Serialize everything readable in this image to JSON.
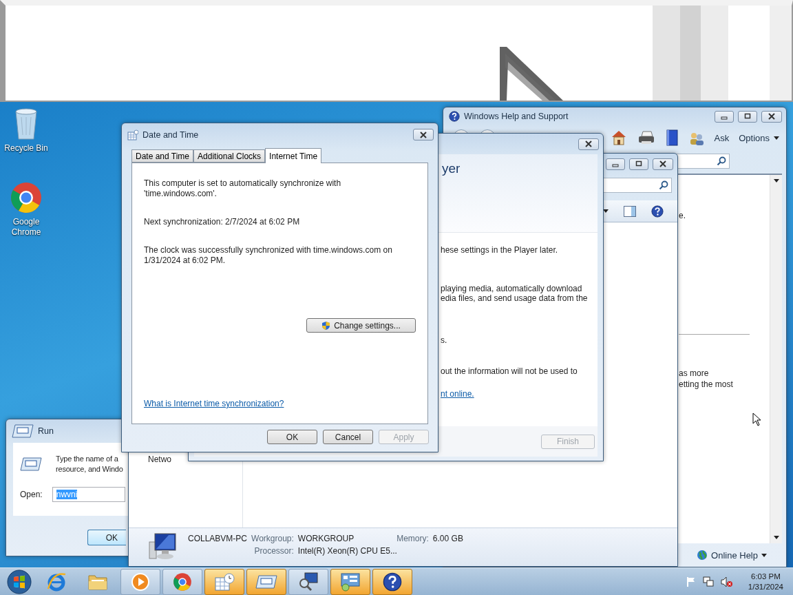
{
  "desktop_icons": [
    {
      "label": "Recycle Bin",
      "kind": "bin"
    },
    {
      "label": "Google Chrome",
      "kind": "chrome"
    }
  ],
  "help_window": {
    "title": "Windows Help and Support",
    "ask": "Ask",
    "options": "Options",
    "fragments": [
      "e.",
      "as more",
      "etting the most"
    ],
    "online_help": "Online Help"
  },
  "explorer_window": {
    "nav_item": "Netwo",
    "computer_name": "COLLABVM-PC",
    "workgroup_label": "Workgroup:",
    "workgroup": "WORKGROUP",
    "memory_label": "Memory:",
    "memory": "6.00 GB",
    "processor_label": "Processor:",
    "processor": "Intel(R) Xeon(R) CPU E5..."
  },
  "media_dialog": {
    "heading": "yer",
    "paragraphs": [
      [
        "hese settings in the Player later."
      ],
      [
        "playing media, automatically download",
        "edia files, and send usage data from the"
      ],
      [
        "s."
      ],
      [
        "out the information will not be used to"
      ]
    ],
    "link": "nt online.",
    "finish": {
      "label": "Finish",
      "disabled": true
    }
  },
  "run_dialog": {
    "title": "Run",
    "prompt": [
      "Type the name of a",
      "resource, and Windo"
    ],
    "open_label": "Open:",
    "value": "nwvni",
    "ok": "OK"
  },
  "date_time": {
    "title": "Date and Time",
    "tabs": [
      {
        "label": "Date and Time",
        "selected": false
      },
      {
        "label": "Additional Clocks",
        "selected": false
      },
      {
        "label": "Internet Time",
        "selected": true
      }
    ],
    "paragraphs": [
      [
        "This computer is set to automatically synchronize with",
        "'time.windows.com'."
      ],
      [
        "Next synchronization: 2/7/2024 at 6:02 PM"
      ],
      [
        "The clock was successfully synchronized with time.windows.com on",
        "1/31/2024 at 6:02 PM."
      ]
    ],
    "change_button": "Change settings...",
    "link": "What is Internet time synchronization?",
    "buttons": [
      {
        "label": "OK",
        "disabled": false
      },
      {
        "label": "Cancel",
        "disabled": false
      },
      {
        "label": "Apply",
        "disabled": true
      }
    ]
  },
  "taskbar": {
    "apps": [
      {
        "kind": "media",
        "highlighted": false
      },
      {
        "kind": "chrome",
        "highlighted": false
      },
      {
        "kind": "clock",
        "highlighted": true
      },
      {
        "kind": "run",
        "highlighted": true
      },
      {
        "kind": "computer",
        "highlighted": false
      },
      {
        "kind": "control",
        "highlighted": true
      },
      {
        "kind": "help",
        "highlighted": true
      }
    ],
    "time": "6:03 PM",
    "date": "1/31/2024"
  }
}
